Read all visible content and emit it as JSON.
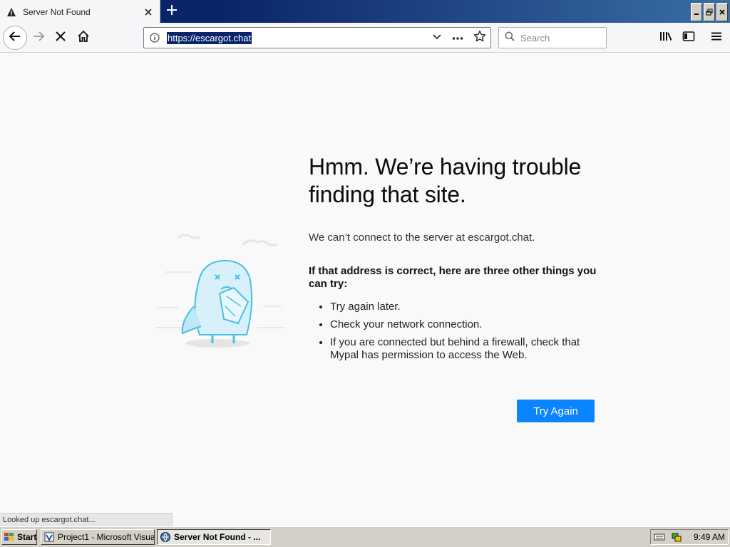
{
  "tab": {
    "title": "Server Not Found"
  },
  "nav": {
    "url": "https://escargot.chat",
    "search_placeholder": "Search"
  },
  "error": {
    "title_line1": "Hmm. We’re having trouble",
    "title_line2": "finding that site.",
    "description": "We can’t connect to the server at escargot.chat.",
    "subheading": "If that address is correct, here are three other things you can try:",
    "suggestions": [
      "Try again later.",
      "Check your network connection.",
      "If you are connected but behind a firewall, check that Mypal has permission to access the Web."
    ],
    "button": "Try Again"
  },
  "status_text": "Looked up escargot.chat...",
  "taskbar": {
    "start": "Start",
    "items": [
      "Project1 - Microsoft Visual...",
      "Server Not Found - ..."
    ],
    "clock": "9:49 AM"
  },
  "colors": {
    "accent": "#0a84ff",
    "titlebar": "#0a246a",
    "selection": "#0a246a"
  },
  "icons": [
    "warning-icon",
    "close-icon",
    "plus-icon",
    "back-icon",
    "forward-icon",
    "stop-icon",
    "home-icon",
    "info-icon",
    "chevron-down-icon",
    "more-icon",
    "star-icon",
    "search-icon",
    "library-icon",
    "sidebar-icon",
    "menu-icon"
  ]
}
